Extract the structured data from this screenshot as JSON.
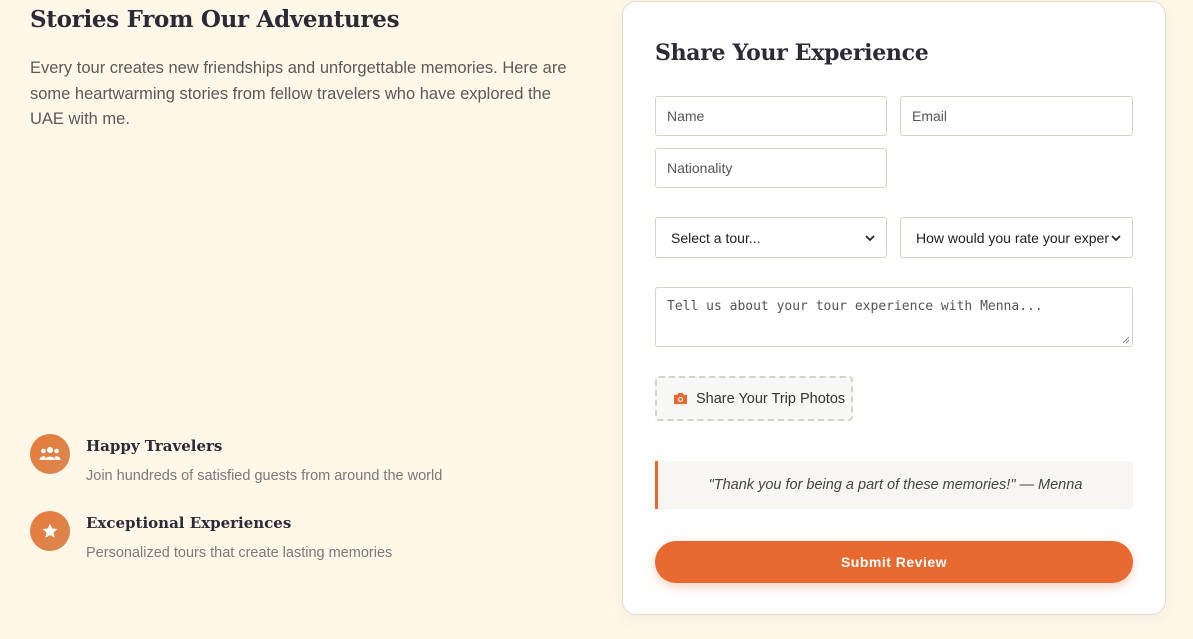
{
  "stories": {
    "title": "Stories From Our Adventures",
    "intro": "Every tour creates new friendships and unforgettable memories. Here are some heartwarming stories from fellow travelers who have explored the UAE with me."
  },
  "features": [
    {
      "icon": "users-icon",
      "title": "Happy Travelers",
      "description": "Join hundreds of satisfied guests from around the world"
    },
    {
      "icon": "star-icon",
      "title": "Exceptional Experiences",
      "description": "Personalized tours that create lasting memories"
    }
  ],
  "form": {
    "title": "Share Your Experience",
    "name_placeholder": "Name",
    "email_placeholder": "Email",
    "nationality_placeholder": "Nationality",
    "tour_select": "Select a tour...",
    "rating_select": "How would you rate your exper",
    "message_placeholder": "Tell us about your tour experience with Menna...",
    "upload_label": "Share Your Trip Photos",
    "quote": "\"Thank you for being a part of these memories!\" — Menna",
    "submit_label": "Submit Review"
  },
  "colors": {
    "accent": "#e8692f",
    "background": "#fff7e8",
    "badge_gradient_start": "#e87a3a",
    "badge_gradient_end": "#d98850"
  }
}
